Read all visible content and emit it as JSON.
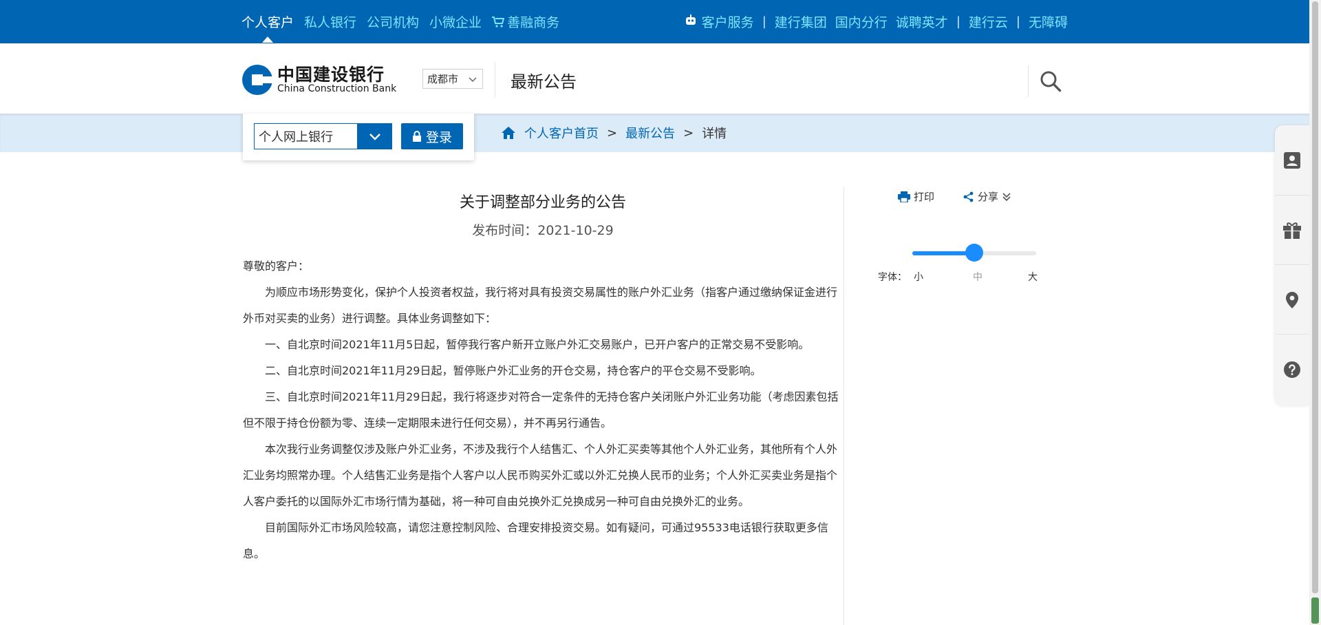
{
  "topnav": {
    "left": [
      "个人客户",
      "私人银行",
      "公司机构",
      "小微企业",
      "善融商务"
    ],
    "active_index": 0,
    "right": [
      "客户服务",
      "建行集团",
      "国内分行",
      "诚聘英才",
      "建行云",
      "无障碍"
    ],
    "separator": "|"
  },
  "header": {
    "logo_cn": "中国建设银行",
    "logo_en": "China Construction Bank",
    "city": "成都市",
    "page_title": "最新公告"
  },
  "login": {
    "bank_select": "个人网上银行",
    "login_label": "登录"
  },
  "breadcrumb": {
    "home": "个人客户首页",
    "section": "最新公告",
    "current": "详情",
    "separator": ">"
  },
  "article": {
    "title": "关于调整部分业务的公告",
    "date": "发布时间：2021-10-29",
    "greeting": "尊敬的客户：",
    "paragraphs": [
      "为顺应市场形势变化，保护个人投资者权益，我行将对具有投资交易属性的账户外汇业务（指客户通过缴纳保证金进行外币对买卖的业务）进行调整。具体业务调整如下：",
      "一、自北京时间2021年11月5日起，暂停我行客户新开立账户外汇交易账户，已开户客户的正常交易不受影响。",
      "二、自北京时间2021年11月29日起，暂停账户外汇业务的开仓交易，持仓客户的平仓交易不受影响。",
      "三、自北京时间2021年11月29日起，我行将逐步对符合一定条件的无持仓客户关闭账户外汇业务功能（考虑因素包括但不限于持仓份额为零、连续一定期限未进行任何交易），并不再另行通告。",
      "本次我行业务调整仅涉及账户外汇业务，不涉及我行个人结售汇、个人外汇买卖等其他个人外汇业务，其他所有个人外汇业务均照常办理。个人结售汇业务是指个人客户以人民币购买外汇或以外汇兑换人民币的业务；个人外汇买卖业务是指个人客户委托的以国际外汇市场行情为基础，将一种可自由兑换外汇兑换成另一种可自由兑换外汇的业务。",
      "目前国际外汇市场风险较高，请您注意控制风险、合理安排投资交易。如有疑问，可通过95533电话银行获取更多信息。"
    ]
  },
  "tools": {
    "print": "打印",
    "share": "分享",
    "font_label": "字体：",
    "sizes": [
      "小",
      "中",
      "大"
    ],
    "font_level": 0.5
  },
  "colors": {
    "brand_blue": "#0066b3",
    "nav_cyan": "#7fe3ff",
    "band": "#dcebf8",
    "slider": "#1a8cff"
  },
  "rail_icons": [
    "user-card-icon",
    "gift-icon",
    "location-icon",
    "help-icon"
  ]
}
